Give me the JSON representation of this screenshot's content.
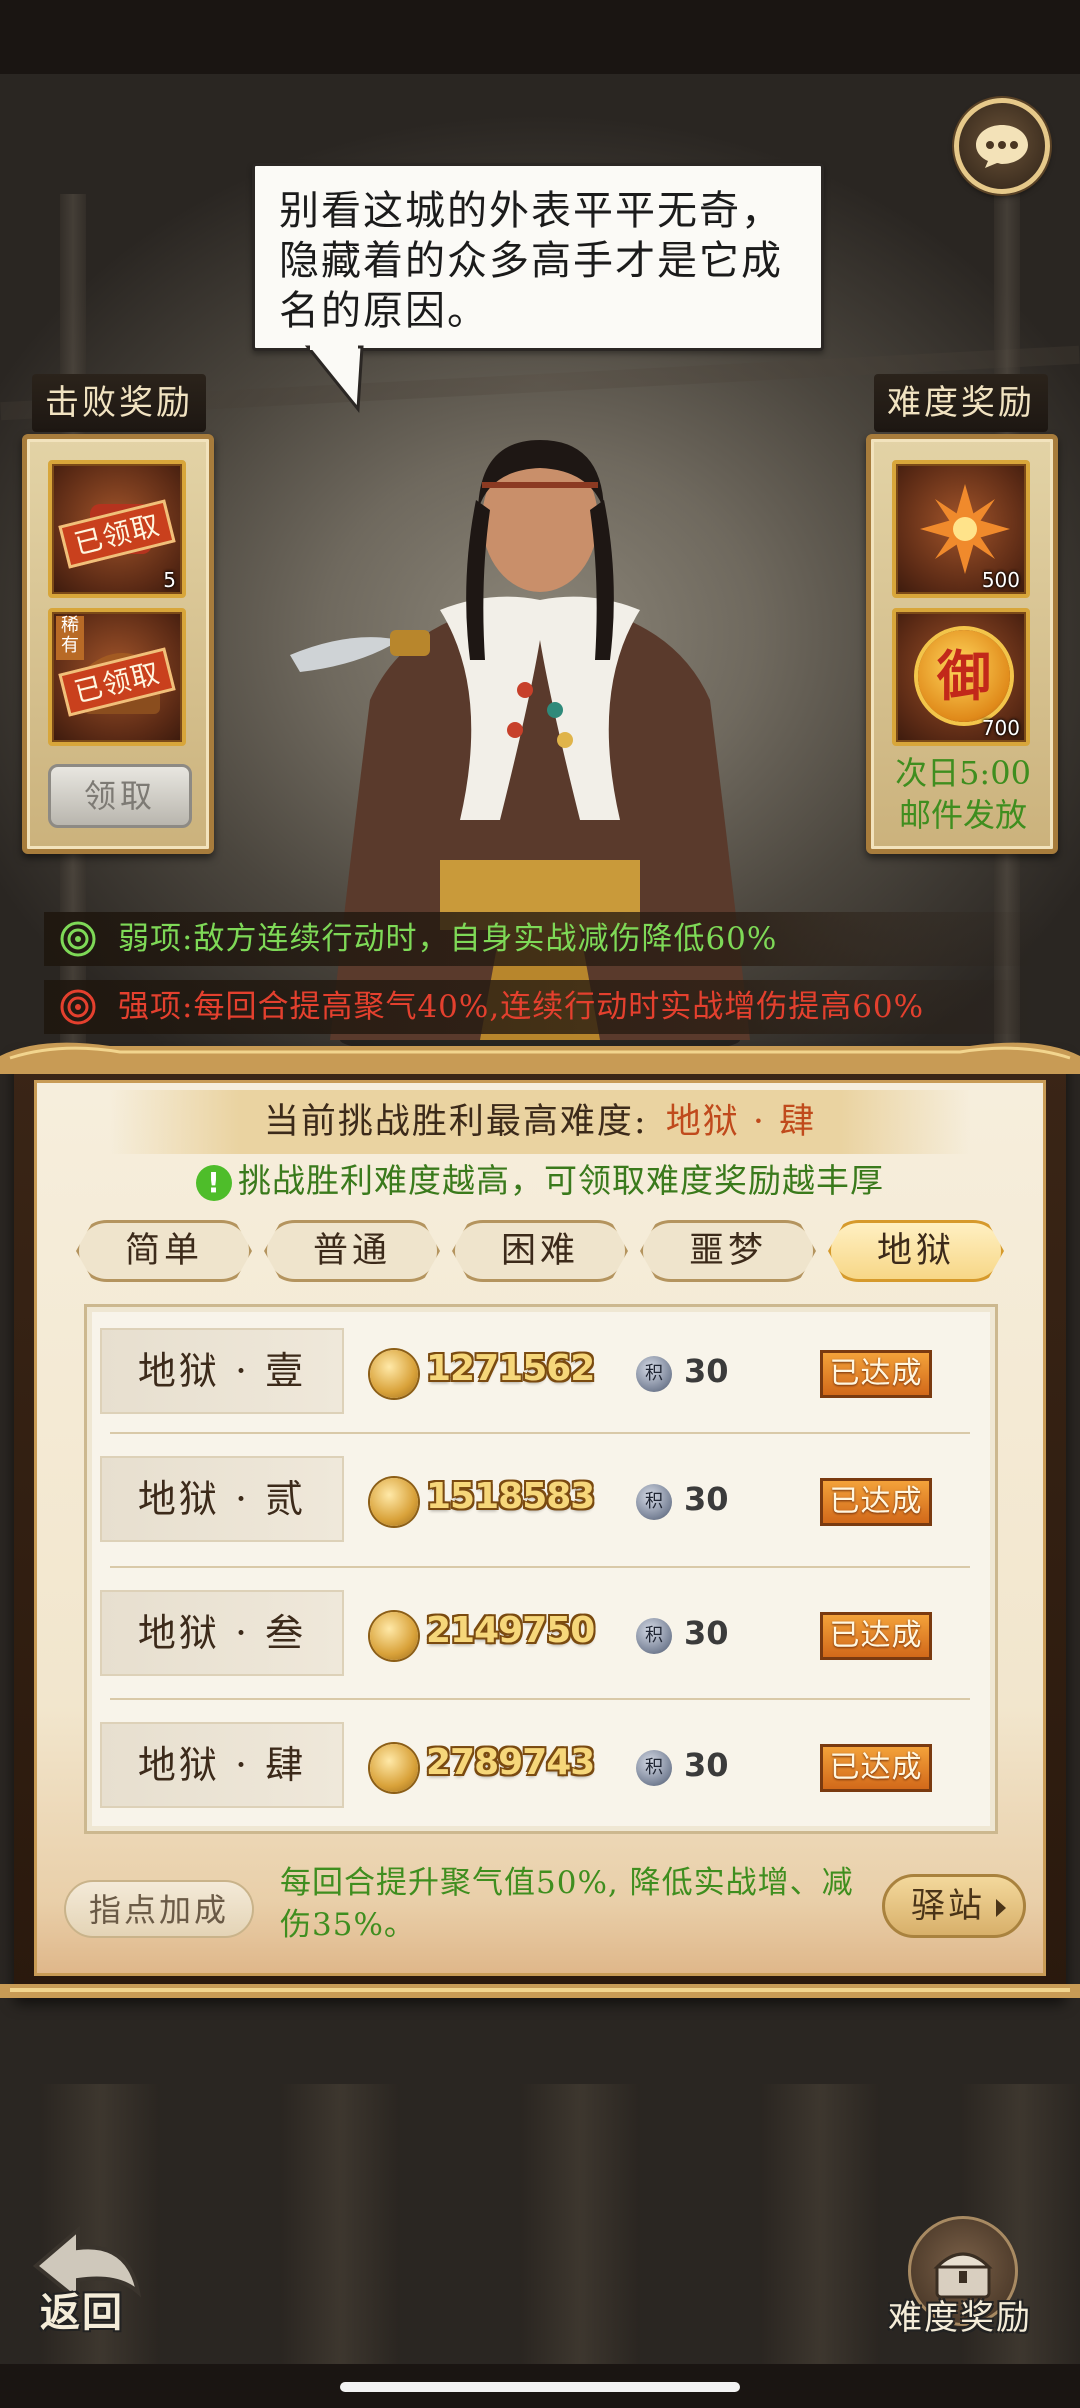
{
  "speech": {
    "lines": [
      "别看这城的外表平平无奇，",
      "隐藏着的众多高手才是它成",
      "名的原因。"
    ]
  },
  "defeat_reward": {
    "title": "击败奖励",
    "items": [
      {
        "icon": "red-scroll-icon",
        "stamp": "已领取",
        "count": "5"
      },
      {
        "icon": "treasure-chest-icon",
        "tag": "稀有",
        "stamp": "已领取"
      }
    ],
    "claim_label": "领取"
  },
  "difficulty_reward": {
    "title": "难度奖励",
    "items": [
      {
        "icon": "flame-flower-icon",
        "count": "500"
      },
      {
        "icon": "yu-coin-icon",
        "glyph": "御",
        "count": "700"
      }
    ],
    "note_line1": "次日5:00",
    "note_line2": "邮件发放"
  },
  "traits": {
    "weak": "弱项:敌方连续行动时，自身实战减伤降低60%",
    "strong": "强项:每回合提高聚气40%,连续行动时实战增伤提高60%",
    "weak_color": "#7ed957",
    "strong_color": "#e4402e"
  },
  "panel": {
    "highest_label": "当前挑战胜利最高难度:",
    "highest_value": "地狱 · 肆",
    "hint": "挑战胜利难度越高，可领取难度奖励越丰厚",
    "tabs": [
      {
        "label": "简单",
        "active": false
      },
      {
        "label": "普通",
        "active": false
      },
      {
        "label": "困难",
        "active": false
      },
      {
        "label": "噩梦",
        "active": false
      },
      {
        "label": "地狱",
        "active": true
      }
    ],
    "rows": [
      {
        "name": "地狱 · 壹",
        "power": "1271562",
        "points_icon": "积",
        "points": "30",
        "status": "已达成"
      },
      {
        "name": "地狱 · 贰",
        "power": "1518583",
        "points_icon": "积",
        "points": "30",
        "status": "已达成"
      },
      {
        "name": "地狱 · 叁",
        "power": "2149750",
        "points_icon": "积",
        "points": "30",
        "status": "已达成"
      },
      {
        "name": "地狱 · 肆",
        "power": "2789743",
        "points_icon": "积",
        "points": "30",
        "status": "已达成"
      }
    ],
    "bonus_label": "指点加成",
    "bonus_text": "每回合提升聚气值50%, 降低实战增、减伤35%。",
    "station_label": "驿站"
  },
  "bottom": {
    "back_label": "返回",
    "difficulty_reward_label": "难度奖励"
  }
}
